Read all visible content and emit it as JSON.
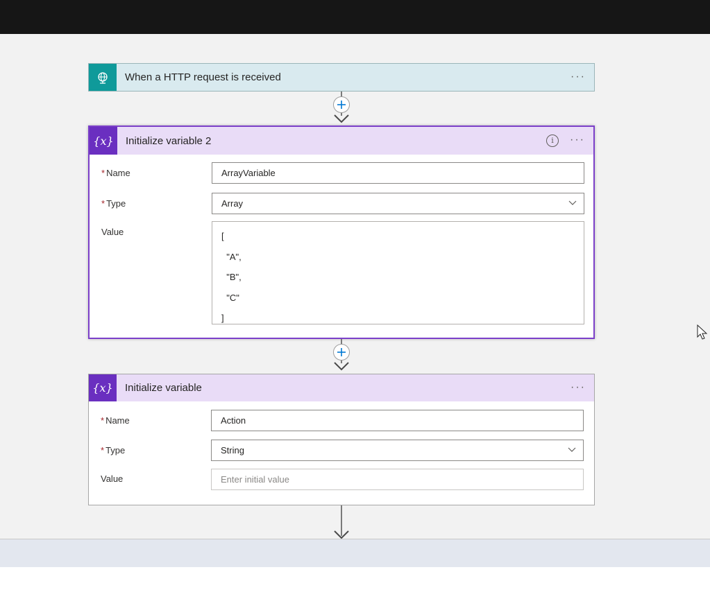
{
  "trigger": {
    "title": "When a HTTP request is received",
    "more_label": "···",
    "icon": "globe-icon"
  },
  "init_var_2": {
    "title": "Initialize variable 2",
    "info_label": "i",
    "more_label": "···",
    "name_label": "Name",
    "name_value": "ArrayVariable",
    "type_label": "Type",
    "type_value": "Array",
    "value_label": "Value",
    "value_lines": [
      "[",
      "  \"A\",",
      "  \"B\",",
      "  \"C\"",
      "]"
    ],
    "icon_text": "{x}"
  },
  "init_var": {
    "title": "Initialize variable",
    "more_label": "···",
    "name_label": "Name",
    "name_value": "Action",
    "type_label": "Type",
    "type_value": "String",
    "value_label": "Value",
    "value_placeholder": "Enter initial value",
    "icon_text": "{x}"
  },
  "required_mark": "*",
  "colors": {
    "trigger_accent": "#0f9a9a",
    "variable_accent": "#6a2fc0",
    "selected_border": "#7b3fc9",
    "plus_color": "#0078d4"
  }
}
